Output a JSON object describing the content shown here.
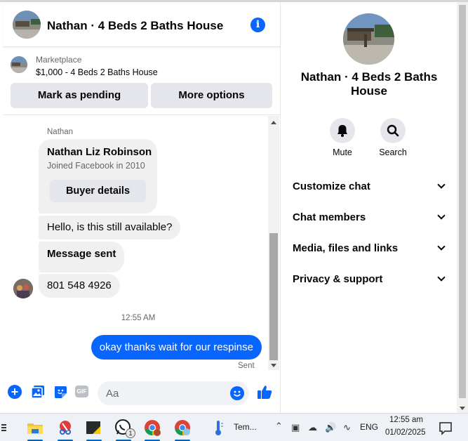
{
  "header": {
    "title": "Nathan · 4 Beds 2 Baths House"
  },
  "marketplace": {
    "label": "Marketplace",
    "listing": "$1,000 - 4 Beds 2 Baths House",
    "mark_pending_label": "Mark as pending",
    "more_options_label": "More options"
  },
  "messages": {
    "sender_name": "Nathan",
    "profile_card": {
      "name": "Nathan Liz Robinson",
      "joined": "Joined Facebook in 2010",
      "button_label": "Buyer details"
    },
    "incoming": [
      "Hello, is this still available?",
      "Message sent",
      "801 548 4926"
    ],
    "timestamp": "12:55 AM",
    "outgoing": "okay thanks wait for our respinse",
    "status": "Sent"
  },
  "composer": {
    "placeholder": "Aa",
    "gif_label": "GIF"
  },
  "details": {
    "title": "Nathan · 4 Beds 2 Baths House",
    "actions": [
      {
        "label": "Mute",
        "icon": "bell-icon"
      },
      {
        "label": "Search",
        "icon": "search-icon"
      }
    ],
    "sections": [
      "Customize chat",
      "Chat members",
      "Media, files and links",
      "Privacy & support"
    ]
  },
  "taskbar": {
    "temp_label": "Tem...",
    "language": "ENG",
    "time": "12:55 am",
    "date": "01/02/2025",
    "whatsapp_badge": "1"
  },
  "colors": {
    "accent": "#0866ff",
    "bubble_gray": "#f0f0f0",
    "button_gray": "#e4e6eb"
  }
}
